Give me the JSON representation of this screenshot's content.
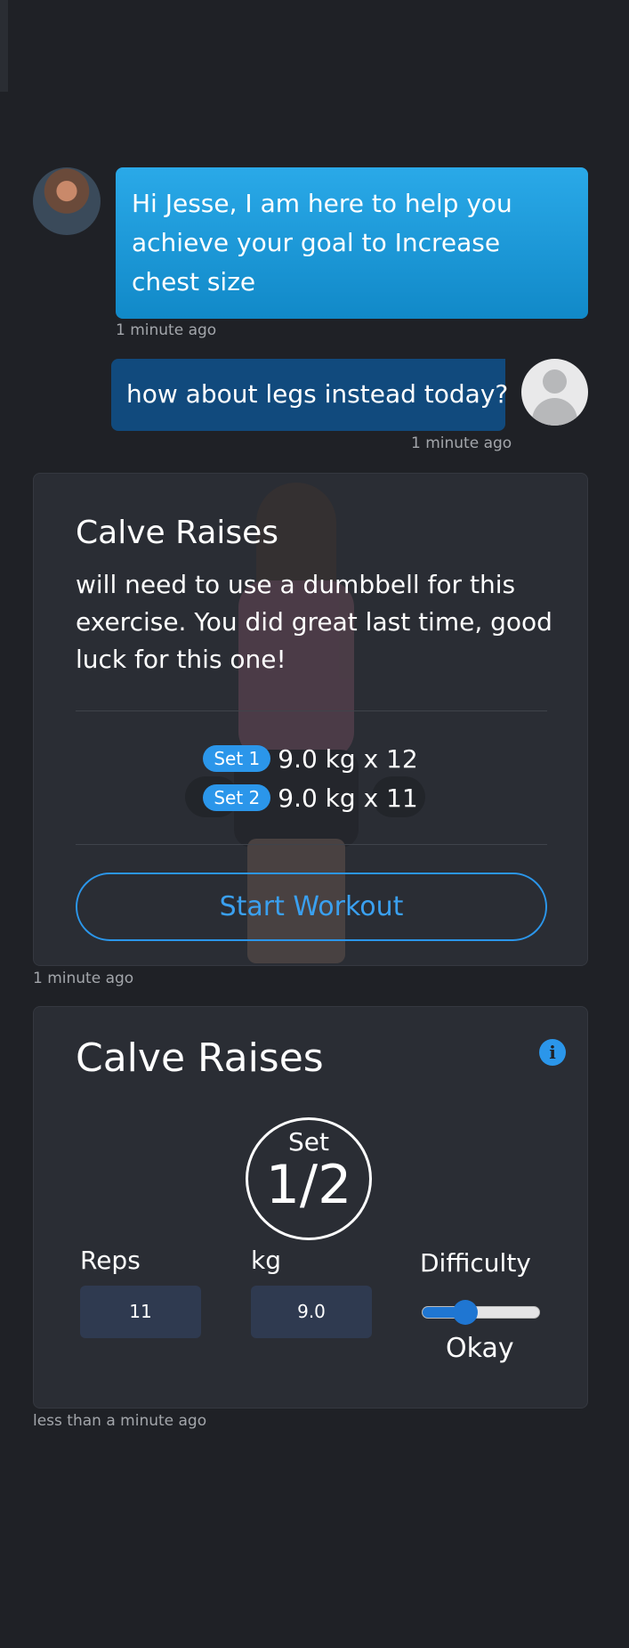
{
  "chat": {
    "bot_message": "Hi Jesse, I am here to help you achieve your goal to Increase chest size",
    "bot_time": "1 minute ago",
    "user_message": "how about legs instead today?",
    "user_time": "1 minute ago"
  },
  "workout_card": {
    "title": "Calve Raises",
    "description": "will need to use a dumbbell for this exercise. You did great last time, good luck for this one!",
    "sets": [
      {
        "label": "Set 1",
        "value": "9.0 kg x 12"
      },
      {
        "label": "Set 2",
        "value": "9.0 kg x 11"
      }
    ],
    "start_label": "Start Workout",
    "time": "1 minute ago"
  },
  "tracker_card": {
    "title": "Calve Raises",
    "set_label": "Set",
    "set_count": "1/2",
    "reps_label": "Reps",
    "reps_value": "11",
    "kg_label": "kg",
    "kg_value": "9.0",
    "difficulty_label": "Difficulty",
    "difficulty_value": "Okay",
    "difficulty_level": 0.33,
    "time": "less than a minute ago"
  },
  "colors": {
    "accent": "#2b96ea",
    "background": "#1f2126",
    "card": "#2a2d34"
  },
  "icons": {
    "info": "info-icon"
  }
}
